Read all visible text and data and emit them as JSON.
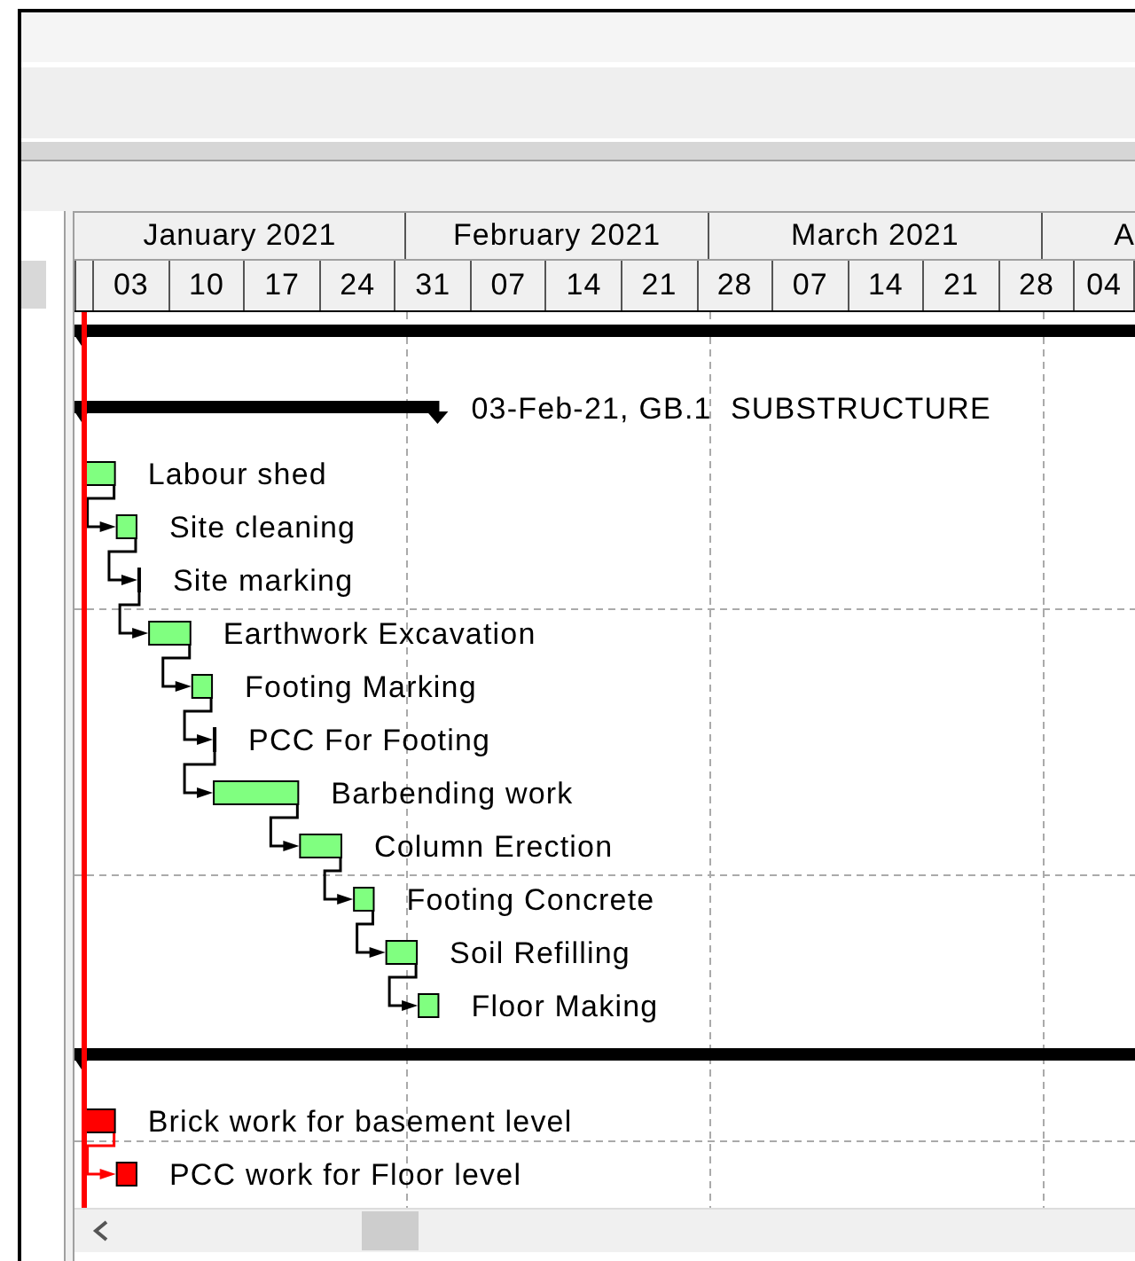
{
  "timescale": {
    "months": [
      {
        "label": "January 2021"
      },
      {
        "label": "February 2021"
      },
      {
        "label": "March 2021"
      },
      {
        "label": "A"
      }
    ],
    "weeks": [
      "03",
      "10",
      "17",
      "24",
      "31",
      "07",
      "14",
      "21",
      "28",
      "07",
      "14",
      "21",
      "28",
      "04"
    ]
  },
  "rows": [
    {
      "kind": "summary"
    },
    {
      "kind": "summary",
      "label": "03-Feb-21, GB.1  SUBSTRUCTURE"
    },
    {
      "kind": "task",
      "label": "Labour shed",
      "critical": false
    },
    {
      "kind": "task",
      "label": "Site cleaning",
      "critical": false,
      "linked": true
    },
    {
      "kind": "task",
      "label": "Site marking",
      "critical": false,
      "linked": true
    },
    {
      "kind": "task",
      "label": "Earthwork Excavation",
      "critical": false,
      "linked": true
    },
    {
      "kind": "task",
      "label": "Footing Marking",
      "critical": false,
      "linked": true
    },
    {
      "kind": "task",
      "label": "PCC For Footing",
      "critical": false,
      "linked": true
    },
    {
      "kind": "task",
      "label": "Barbending work",
      "critical": false,
      "linked": true
    },
    {
      "kind": "task",
      "label": "Column Erection",
      "critical": false,
      "linked": true
    },
    {
      "kind": "task",
      "label": "Footing Concrete",
      "critical": false,
      "linked": true
    },
    {
      "kind": "task",
      "label": "Soil Refilling",
      "critical": false,
      "linked": true
    },
    {
      "kind": "task",
      "label": "Floor Making",
      "critical": false,
      "linked": true
    },
    {
      "kind": "summary"
    },
    {
      "kind": "task",
      "label": "Brick work for basement level",
      "critical": true,
      "linked": false
    },
    {
      "kind": "task",
      "label": "PCC work for Floor level",
      "critical": true,
      "linked": true
    }
  ]
}
